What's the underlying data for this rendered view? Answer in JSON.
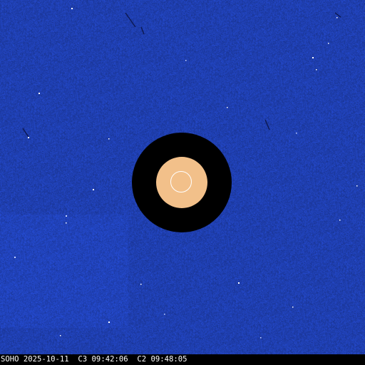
{
  "caption": "SOHO 2025-10-11  C3 09:42:06  C2 09:48:05",
  "colors": {
    "field": "#1f3fb0",
    "field_dark": "#1a329a",
    "field_light": "#2a4cc8",
    "occulter": "#000000",
    "sun_disk": "#f2c08a",
    "sun_outline": "#ffffff",
    "caption_bg": "#000000",
    "caption_text": "#ffffff"
  }
}
